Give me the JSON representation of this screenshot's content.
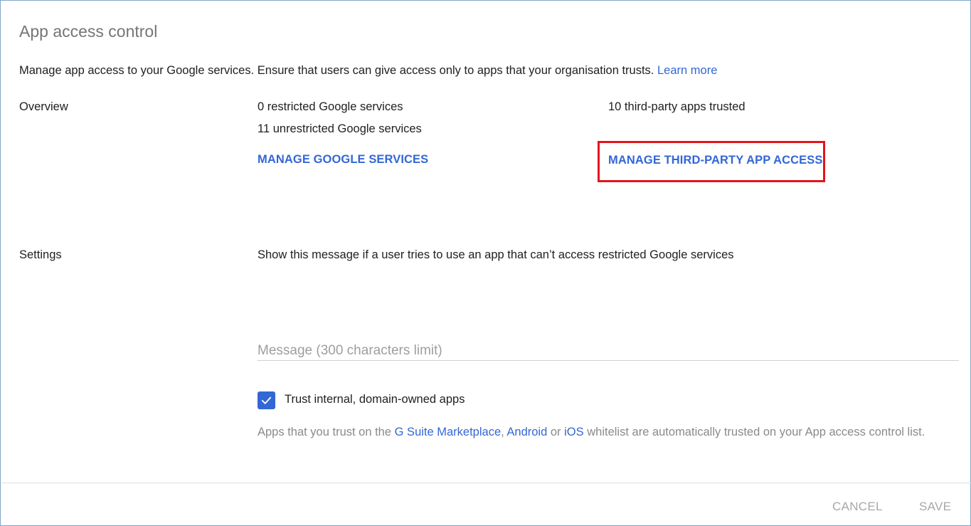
{
  "title": "App access control",
  "intro": {
    "text": "Manage app access to your Google services. Ensure that users can give access only to apps that your organisation trusts.",
    "learn_more": "Learn more"
  },
  "overview": {
    "label": "Overview",
    "restricted": "0 restricted Google services",
    "unrestricted": "11 unrestricted Google services",
    "manage_google_services": "MANAGE GOOGLE SERVICES",
    "third_party_trusted": "10 third-party apps trusted",
    "manage_third_party": "MANAGE THIRD-PARTY APP ACCESS"
  },
  "settings": {
    "label": "Settings",
    "description": "Show this message if a user tries to use an app that can’t access restricted Google services",
    "message_placeholder": "Message (300 characters limit)",
    "message_value": "",
    "trust_internal": {
      "label": "Trust internal, domain-owned apps",
      "checked": true
    },
    "helper": {
      "prefix": "Apps that you trust on the",
      "link1": "G Suite Marketplace",
      "sep1": ",",
      "link2": "Android",
      "sep2": "or",
      "link3": "iOS",
      "suffix": "whitelist are automatically trusted on your App access control list."
    }
  },
  "footer": {
    "cancel": "CANCEL",
    "save": "SAVE"
  },
  "colors": {
    "accent": "#3367d6",
    "highlight": "#e3141c",
    "title": "#757575",
    "muted": "#a8a8a8"
  }
}
